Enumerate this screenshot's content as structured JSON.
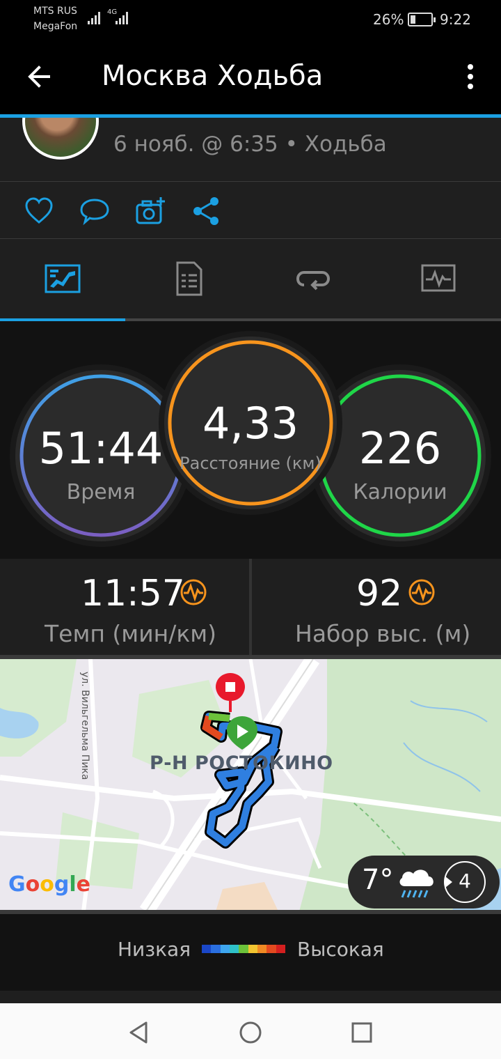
{
  "status_bar": {
    "carrier_line1": "MTS RUS",
    "carrier_line2": "MegaFon",
    "network": "4G",
    "battery_percent": "26%",
    "battery_level": 0.26,
    "time": "9:22"
  },
  "app_bar": {
    "title": "Москва Ходьба",
    "back_icon": "arrow-left-icon",
    "menu_icon": "more-vertical-icon"
  },
  "activity": {
    "subtitle": "6 нояб. @ 6:35 • Ходьба"
  },
  "actions": [
    "like",
    "comment",
    "add-photo",
    "share"
  ],
  "tabs": [
    {
      "name": "overview",
      "icon": "dashboard-icon",
      "selected": true
    },
    {
      "name": "stats",
      "icon": "document-list-icon",
      "selected": false
    },
    {
      "name": "laps",
      "icon": "loop-icon",
      "selected": false
    },
    {
      "name": "charts",
      "icon": "chart-icon",
      "selected": false
    }
  ],
  "rings": {
    "time": {
      "value": "51:44",
      "label": "Время",
      "color_start": "#3fa0e6",
      "color_end": "#7b5fc2"
    },
    "distance": {
      "value": "4,33",
      "label": "Расстояние (км)",
      "color": "#f7941d"
    },
    "calories": {
      "value": "226",
      "label": "Калории",
      "color": "#1fd648"
    }
  },
  "metrics": {
    "pace": {
      "value": "11:57",
      "label": "Темп (мин/км)",
      "icon": "pulse-icon"
    },
    "elevation": {
      "value": "92",
      "label": "Набор выс. (м)",
      "icon": "pulse-icon"
    }
  },
  "map": {
    "area_label": "Р-Н РОСТОКИНО",
    "street_label": "ул. Вильгельма Пика",
    "attribution": "Google",
    "weather": {
      "temperature": "7°",
      "icon": "rain-cloud-icon",
      "wind_speed": "4"
    }
  },
  "legend": {
    "low": "Низкая",
    "high": "Высокая",
    "colors": [
      "#1a47c8",
      "#2a6fe0",
      "#3ea6ef",
      "#2fc1c8",
      "#6cc23a",
      "#f2c531",
      "#f08a24",
      "#e34a1f",
      "#d41f1f"
    ]
  },
  "nav": [
    "back",
    "home",
    "recents"
  ]
}
